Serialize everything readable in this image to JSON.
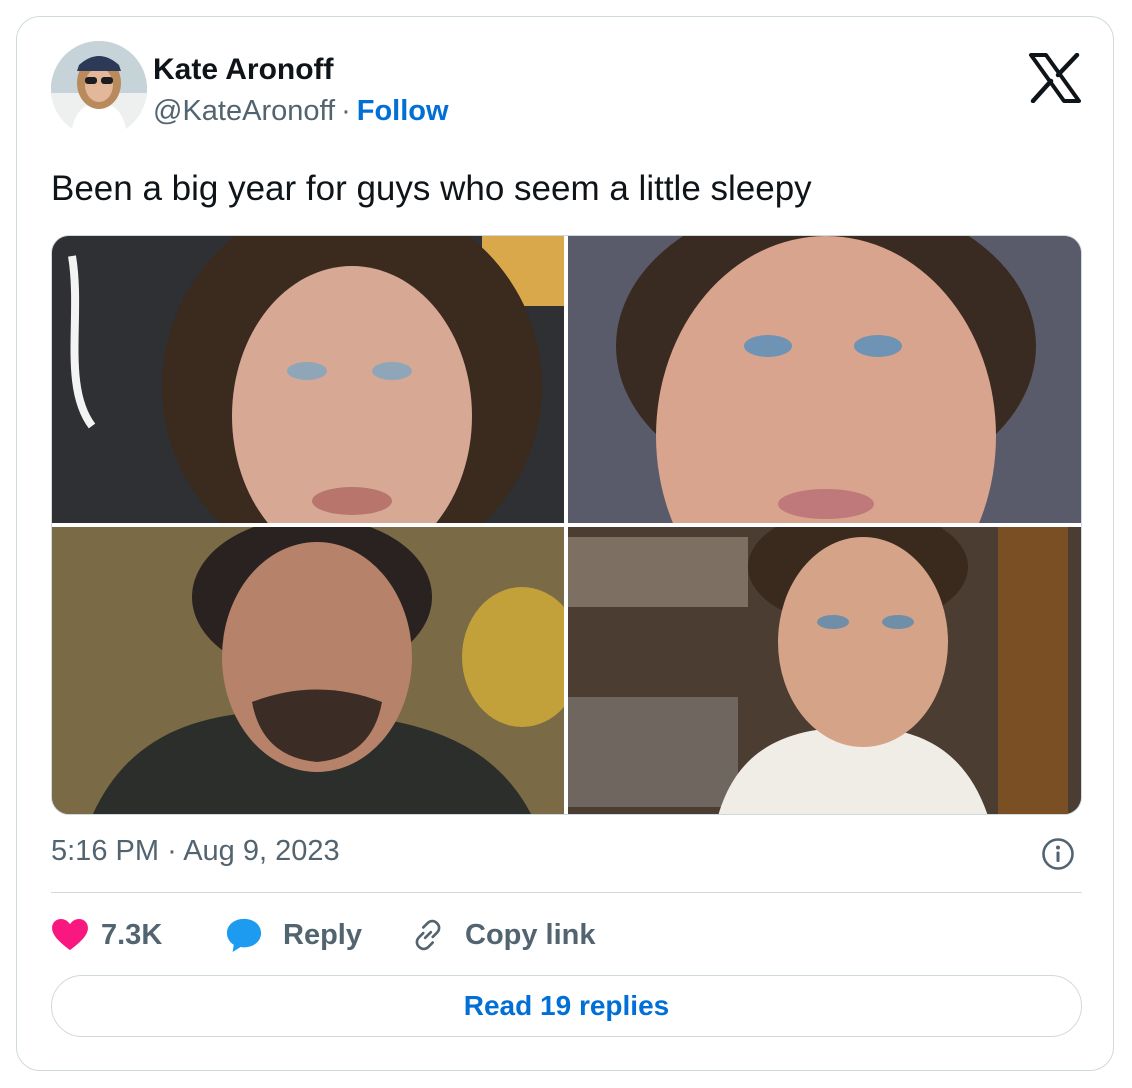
{
  "author": {
    "name": "Kate Aronoff",
    "handle": "@KateAronoff",
    "separator": "·",
    "follow_label": "Follow"
  },
  "tweet": {
    "text": "Been a big year for guys who seem a little sleepy",
    "time": "5:16 PM",
    "separator": "·",
    "date": "Aug 9, 2023"
  },
  "media": {
    "photos": [
      {
        "icon": "portrait-photo"
      },
      {
        "icon": "portrait-photo"
      },
      {
        "icon": "portrait-photo"
      },
      {
        "icon": "portrait-photo"
      }
    ]
  },
  "actions": {
    "likes": "7.3K",
    "reply_label": "Reply",
    "copy_label": "Copy link"
  },
  "read_replies_label": "Read 19 replies",
  "colors": {
    "link": "#006fd6",
    "like": "#f91880",
    "reply": "#1d9bf0",
    "muted": "#536471",
    "border": "#cfd9de"
  }
}
